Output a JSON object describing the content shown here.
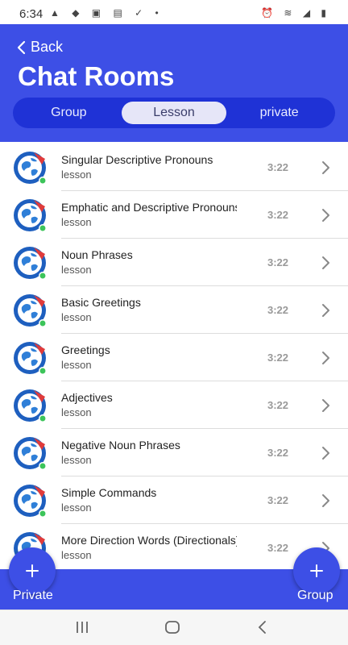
{
  "status": {
    "time": "6:34"
  },
  "header": {
    "back_label": "Back",
    "title": "Chat Rooms",
    "tabs": [
      "Group",
      "Lesson",
      "private"
    ],
    "active_tab": 1
  },
  "rooms": [
    {
      "name": "Singular Descriptive Pronouns",
      "type": "lesson",
      "time": "3:22"
    },
    {
      "name": "Emphatic and Descriptive Pronouns",
      "type": "lesson",
      "time": "3:22"
    },
    {
      "name": "Noun Phrases",
      "type": "lesson",
      "time": "3:22"
    },
    {
      "name": "Basic Greetings",
      "type": "lesson",
      "time": "3:22"
    },
    {
      "name": "Greetings",
      "type": "lesson",
      "time": "3:22"
    },
    {
      "name": "Adjectives",
      "type": "lesson",
      "time": "3:22"
    },
    {
      "name": "Negative Noun Phrases",
      "type": "lesson",
      "time": "3:22"
    },
    {
      "name": "Simple Commands",
      "type": "lesson",
      "time": "3:22"
    },
    {
      "name": "More Direction Words (Directionals)",
      "type": "lesson",
      "time": "3:22"
    }
  ],
  "fabs": {
    "private_label": "Private",
    "group_label": "Group"
  },
  "colors": {
    "primary": "#3d4fe6",
    "tab_track": "#1f32d6",
    "tab_active": "#e6e6f8",
    "online_dot": "#3cc45a"
  }
}
